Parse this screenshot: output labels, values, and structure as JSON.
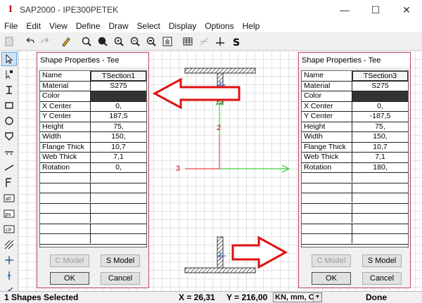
{
  "window": {
    "title": "SAP2000 - IPE300PETEK",
    "icon": "sap-logo-icon",
    "minimize": "—",
    "maximize": "☐",
    "close": "✕"
  },
  "menu": [
    "File",
    "Edit",
    "View",
    "Define",
    "Draw",
    "Select",
    "Display",
    "Options",
    "Help"
  ],
  "canvas": {
    "axis_horizontal_label": "3",
    "axis_vertical_label": "2"
  },
  "left_dialog": {
    "title": "Shape Properties - Tee",
    "rows": [
      {
        "label": "Name",
        "value": "TSection1"
      },
      {
        "label": "Material",
        "value": "S275"
      },
      {
        "label": "Color",
        "value": ""
      },
      {
        "label": "X Center",
        "value": "0,"
      },
      {
        "label": "Y Center",
        "value": "187,5"
      },
      {
        "label": "Height",
        "value": "75,"
      },
      {
        "label": "Width",
        "value": "150,"
      },
      {
        "label": "Flange Thick",
        "value": "10,7"
      },
      {
        "label": "Web Thick",
        "value": "7,1"
      },
      {
        "label": "Rotation",
        "value": "0,"
      }
    ],
    "btn_cmodel": "C Model",
    "btn_smodel": "S Model",
    "btn_ok": "OK",
    "btn_cancel": "Cancel"
  },
  "right_dialog": {
    "title": "Shape Properties - Tee",
    "rows": [
      {
        "label": "Name",
        "value": "TSection3"
      },
      {
        "label": "Material",
        "value": "S275"
      },
      {
        "label": "Color",
        "value": ""
      },
      {
        "label": "X Center",
        "value": "0,"
      },
      {
        "label": "Y Center",
        "value": "-187,5"
      },
      {
        "label": "Height",
        "value": "75,"
      },
      {
        "label": "Width",
        "value": "150,"
      },
      {
        "label": "Flange Thick",
        "value": "10,7"
      },
      {
        "label": "Web Thick",
        "value": "7,1"
      },
      {
        "label": "Rotation",
        "value": "180,"
      }
    ],
    "btn_cmodel": "C Model",
    "btn_smodel": "S Model",
    "btn_ok": "OK",
    "btn_cancel": "Cancel"
  },
  "status": {
    "selection": "1 Shapes Selected",
    "x": "X = 26,31",
    "y": "Y = 216,00",
    "units": "KN, mm, C",
    "state": "Done"
  },
  "colors": {
    "axis_green": "#22cc22",
    "axis_red": "#ee2222",
    "dialog_border": "#c0455a",
    "annotation_arrow": "#e01010"
  }
}
